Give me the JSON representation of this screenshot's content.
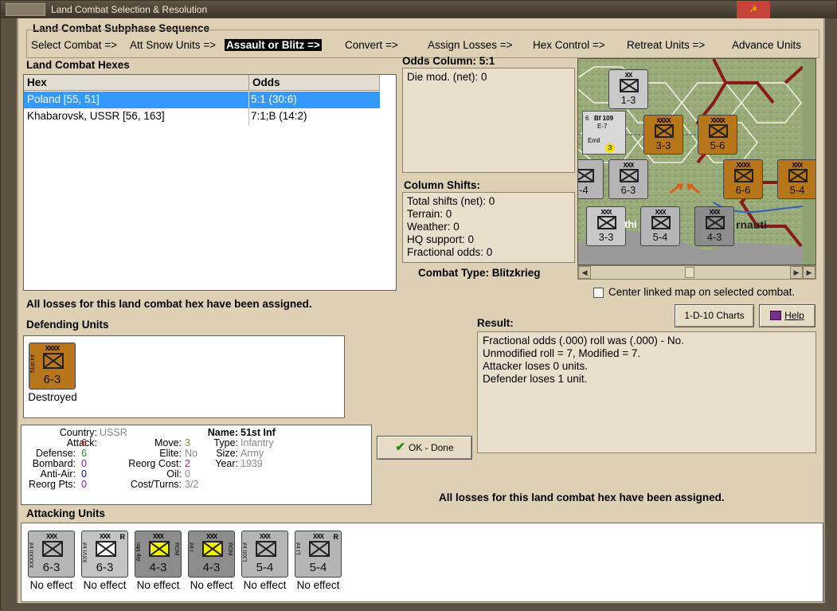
{
  "window": {
    "title": "Land Combat Selection & Resolution",
    "close_glyph": "☭"
  },
  "sequence": {
    "title": "Land Combat Subphase Sequence",
    "steps": [
      "Select Combat =>",
      "Att Snow Units =>",
      "Assault or Blitz =>",
      "Convert =>",
      "Assign Losses =>",
      "Hex Control =>",
      "Retreat Units =>",
      "Advance Units"
    ],
    "active_step": "Assault or Blitz =>"
  },
  "hexes": {
    "title": "Land Combat Hexes",
    "col_hex": "Hex",
    "col_odds": "Odds",
    "rows": [
      {
        "hex": "Poland [55, 51]",
        "odds": "5:1 (30:6)",
        "selected": true
      },
      {
        "hex": "Khabarovsk, USSR [56, 163]",
        "odds": "7:1;B (14:2)",
        "selected": false
      }
    ]
  },
  "odds": {
    "title": "Odds Column: 5:1",
    "die_mod": "Die mod. (net): 0"
  },
  "shifts": {
    "title": "Column Shifts:",
    "lines": [
      "Total shifts (net): 0",
      "Terrain: 0",
      "Weather: 0",
      "HQ support: 0",
      "Fractional odds: 0"
    ]
  },
  "combat_type": "Combat Type:  Blitzkrieg",
  "center_map": "Center linked map on selected combat.",
  "losses_msg_top": "All losses for this land combat hex have been assigned.",
  "losses_msg_bottom": "All losses for this land combat hex have been assigned.",
  "buttons": {
    "charts": "1-D-10 Charts",
    "help": "Help",
    "ok": "OK - Done"
  },
  "result": {
    "title": "Result:",
    "lines": [
      "Fractional odds (.000) roll was (.000)  - No.",
      "Unmodified roll = 7, Modified = 7.",
      "Attacker loses 0 units.",
      "Defender loses 1 unit."
    ]
  },
  "defending": {
    "title": "Defending Units",
    "units": [
      {
        "size": "XXXX",
        "name": "51st Inf",
        "combat": "6-3",
        "status": "Destroyed",
        "color": "#b8761a"
      }
    ]
  },
  "unit_info": {
    "country_label": "Country:",
    "country": "USSR",
    "attack_label": "Attack:",
    "attack": "6",
    "defense_label": "Defense:",
    "defense": "6",
    "bombard_label": "Bombard:",
    "bombard": "0",
    "antiair_label": "Anti-Air:",
    "antiair": "0",
    "reorg_pts_label": "Reorg Pts:",
    "reorg_pts": "0",
    "move_label": "Move:",
    "move": "3",
    "elite_label": "Elite:",
    "elite": "No",
    "reorg_cost_label": "Reorg Cost:",
    "reorg_cost": "2",
    "oil_label": "Oil:",
    "oil": "0",
    "cost_turns_label": "Cost/Turns:",
    "cost_turns": "3/2",
    "name_label": "Name:",
    "name": "51st Inf",
    "type_label": "Type:",
    "type": "Infantry",
    "size_label": "Size:",
    "size": "Army",
    "year_label": "Year:",
    "year": "1939"
  },
  "attacking": {
    "title": "Attacking Units",
    "units": [
      {
        "size": "XXX",
        "name": "XXXXII Inf",
        "nat": "",
        "combat": "6-3",
        "status": "No effect",
        "color": "#b5b5b5",
        "sym": "#b5b5b5",
        "r": ""
      },
      {
        "size": "XXX",
        "name": "XXVI Inf",
        "nat": "",
        "combat": "6-3",
        "status": "No effect",
        "color": "#c4c4c4",
        "sym": "#ffffff",
        "r": "R"
      },
      {
        "size": "XXX",
        "name": "Alp Mtn",
        "nat": "ROM",
        "combat": "4-3",
        "status": "No effect",
        "color": "#8c8c8c",
        "sym": "#f0f000",
        "r": ""
      },
      {
        "size": "XXX",
        "name": "I Inf",
        "nat": "ROM",
        "combat": "4-3",
        "status": "No effect",
        "color": "#8c8c8c",
        "sym": "#f0f000",
        "r": ""
      },
      {
        "size": "XXX",
        "name": "LXIII Inf",
        "nat": "",
        "combat": "5-4",
        "status": "No effect",
        "color": "#b5b5b5",
        "sym": "#b5b5b5",
        "r": ""
      },
      {
        "size": "XXX",
        "name": "LI Inf",
        "nat": "",
        "combat": "5-4",
        "status": "No effect",
        "color": "#b5b5b5",
        "sym": "#b5b5b5",
        "r": "R"
      }
    ]
  },
  "map": {
    "label": "rnauti",
    "label2": "thi",
    "units": [
      {
        "combat": "1-3",
        "size": "XX",
        "color": "#c8c8c8"
      },
      {
        "combat": "3-3",
        "size": "XXXX",
        "color": "#b8761a"
      },
      {
        "combat": "5-6",
        "size": "XXXX",
        "color": "#b8761a"
      },
      {
        "combat": "6-3",
        "size": "XXX",
        "color": "#b5b5b5"
      },
      {
        "combat": "6-6",
        "size": "XXXX",
        "color": "#b8761a"
      },
      {
        "combat": "5-4",
        "size": "XXX",
        "color": "#b8761a"
      },
      {
        "combat": "3-3",
        "size": "XXX",
        "color": "#c8c8c8"
      },
      {
        "combat": "5-4",
        "size": "XXX",
        "color": "#b5b5b5"
      },
      {
        "combat": "4-3",
        "size": "XXX",
        "color": "#8c8c8c"
      },
      {
        "combat": "-4",
        "size": "",
        "color": "#b5b5b5"
      }
    ],
    "plane": {
      "type": "Bf 109",
      "variant": "E-7",
      "name": "Emil",
      "num": "6",
      "val": "3"
    }
  }
}
